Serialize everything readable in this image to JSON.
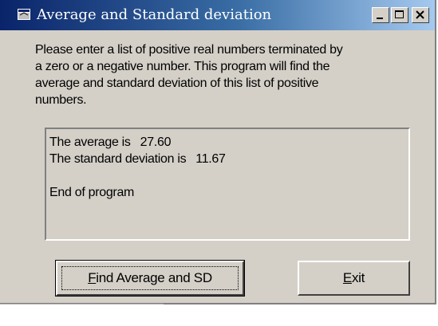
{
  "window": {
    "title": "Average and Standard deviation",
    "accent_color": "#0a246a",
    "face_color": "#d4d0c8"
  },
  "titlebar_buttons": {
    "minimize_icon": "minimize-icon",
    "maximize_icon": "maximize-icon",
    "close_icon": "close-icon"
  },
  "description": "Please enter a list of positive real numbers terminated by\na zero or a negative number. This program will find the\naverage and standard deviation of this list of positive\nnumbers.",
  "output": {
    "average_label": "The average is",
    "average_value": "27.60",
    "sd_label": "The standard deviation is",
    "sd_value": "11.67",
    "end_text": "End of program"
  },
  "buttons": {
    "find_mnemonic": "F",
    "find_rest": "ind Average and SD",
    "exit_mnemonic": "E",
    "exit_rest": "xit"
  }
}
